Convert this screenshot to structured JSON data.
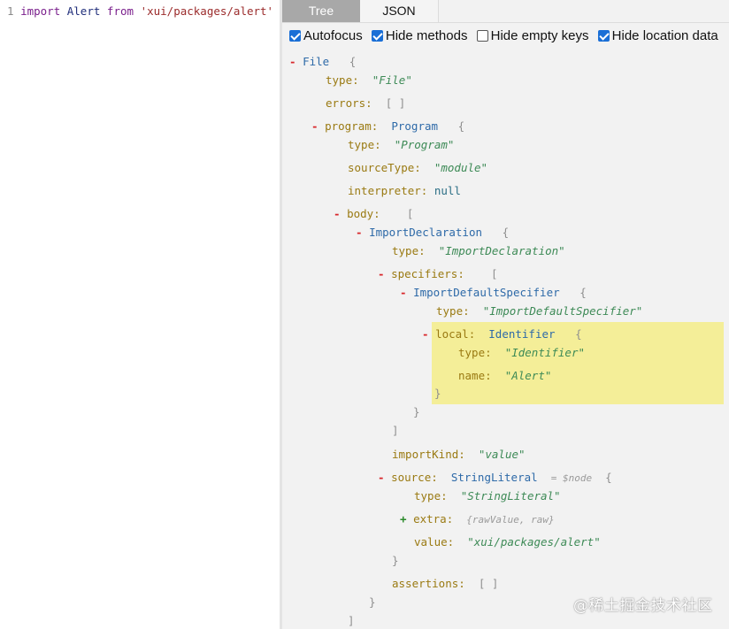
{
  "editor": {
    "line_number": "1",
    "kw_import": "import",
    "ident": "Alert",
    "kw_from": "from",
    "source_str": "'xui/packages/alert'"
  },
  "tabs": {
    "tree": "Tree",
    "json": "JSON"
  },
  "options": [
    {
      "label": "Autofocus",
      "checked": true
    },
    {
      "label": "Hide methods",
      "checked": true
    },
    {
      "label": "Hide empty keys",
      "checked": false
    },
    {
      "label": "Hide location data",
      "checked": true
    }
  ],
  "tree": {
    "file": "File",
    "file_type": "\"File\"",
    "errors_key": "errors:",
    "empty_arr": "[ ]",
    "program_key": "program:",
    "program_type": "Program",
    "program_type_str": "\"Program\"",
    "sourceType_key": "sourceType:",
    "sourceType_val": "\"module\"",
    "interpreter_key": "interpreter:",
    "interpreter_val": "null",
    "body_key": "body:",
    "importdecl": "ImportDeclaration",
    "importdecl_str": "\"ImportDeclaration\"",
    "specifiers_key": "specifiers:",
    "ids": "ImportDefaultSpecifier",
    "ids_str": "\"ImportDefaultSpecifier\"",
    "local_key": "local:",
    "identifier": "Identifier",
    "identifier_str": "\"Identifier\"",
    "name_key": "name:",
    "name_val": "\"Alert\"",
    "importKind_key": "importKind:",
    "importKind_val": "\"value\"",
    "source_key": "source:",
    "stringliteral": "StringLiteral",
    "node_ref": "= $node",
    "stringliteral_str": "\"StringLiteral\"",
    "extra_key": "extra:",
    "extra_summary": "{rawValue, raw}",
    "value_key": "value:",
    "value_val": "\"xui/packages/alert\"",
    "assertions_key": "assertions:",
    "type_key": "type:",
    "open_brace": "{",
    "close_brace": "}",
    "open_bracket": "[",
    "close_bracket": "]",
    "minus": "-",
    "plus": "+"
  },
  "watermark": "@稀土掘金技术社区"
}
